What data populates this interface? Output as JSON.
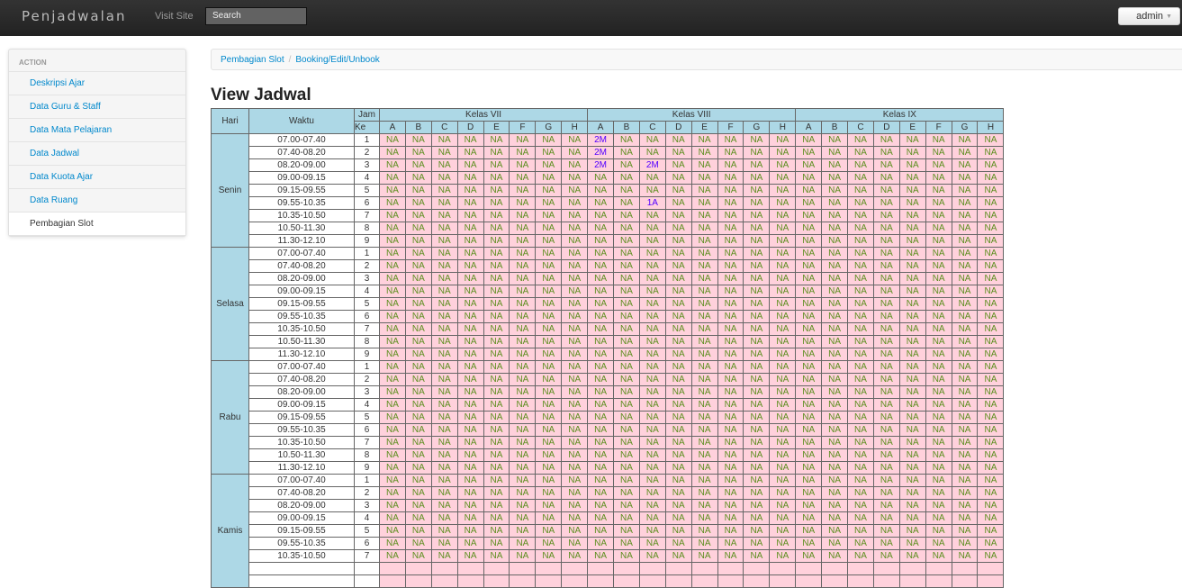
{
  "navbar": {
    "brand": "Penjadwalan",
    "visit_site": "Visit Site",
    "search_placeholder": "Search",
    "user": "admin"
  },
  "sidebar": {
    "header": "ACTION",
    "items": [
      {
        "label": "Deskripsi Ajar"
      },
      {
        "label": "Data Guru & Staff"
      },
      {
        "label": "Data Mata Pelajaran"
      },
      {
        "label": "Data Jadwal"
      },
      {
        "label": "Data Kuota Ajar"
      },
      {
        "label": "Data Ruang"
      },
      {
        "label": "Pembagian Slot",
        "active": true
      }
    ]
  },
  "breadcrumb": {
    "items": [
      "Pembagian Slot",
      "Booking/Edit/Unbook"
    ],
    "separator": "/"
  },
  "page_title": "View Jadwal",
  "table": {
    "headers": {
      "hari": "Hari",
      "waktu": "Waktu",
      "jam": "Jam",
      "ke": "Ke"
    },
    "kelas": [
      "Kelas VII",
      "Kelas VIII",
      "Kelas IX"
    ],
    "sections": [
      "A",
      "B",
      "C",
      "D",
      "E",
      "F",
      "G",
      "H"
    ],
    "default_cell": "NA",
    "days": [
      {
        "name": "Senin",
        "slots": [
          [
            "07.00-07.40",
            "1"
          ],
          [
            "07.40-08.20",
            "2"
          ],
          [
            "08.20-09.00",
            "3"
          ],
          [
            "09.00-09.15",
            "4"
          ],
          [
            "09.15-09.55",
            "5"
          ],
          [
            "09.55-10.35",
            "6"
          ],
          [
            "10.35-10.50",
            "7"
          ],
          [
            "10.50-11.30",
            "8"
          ],
          [
            "11.30-12.10",
            "9"
          ]
        ]
      },
      {
        "name": "Selasa",
        "slots": [
          [
            "07.00-07.40",
            "1"
          ],
          [
            "07.40-08.20",
            "2"
          ],
          [
            "08.20-09.00",
            "3"
          ],
          [
            "09.00-09.15",
            "4"
          ],
          [
            "09.15-09.55",
            "5"
          ],
          [
            "09.55-10.35",
            "6"
          ],
          [
            "10.35-10.50",
            "7"
          ],
          [
            "10.50-11.30",
            "8"
          ],
          [
            "11.30-12.10",
            "9"
          ]
        ]
      },
      {
        "name": "Rabu",
        "slots": [
          [
            "07.00-07.40",
            "1"
          ],
          [
            "07.40-08.20",
            "2"
          ],
          [
            "08.20-09.00",
            "3"
          ],
          [
            "09.00-09.15",
            "4"
          ],
          [
            "09.15-09.55",
            "5"
          ],
          [
            "09.55-10.35",
            "6"
          ],
          [
            "10.35-10.50",
            "7"
          ],
          [
            "10.50-11.30",
            "8"
          ],
          [
            "11.30-12.10",
            "9"
          ]
        ]
      },
      {
        "name": "Kamis",
        "slots": [
          [
            "07.00-07.40",
            "1"
          ],
          [
            "07.40-08.20",
            "2"
          ],
          [
            "08.20-09.00",
            "3"
          ],
          [
            "09.00-09.15",
            "4"
          ],
          [
            "09.15-09.55",
            "5"
          ],
          [
            "09.55-10.35",
            "6"
          ],
          [
            "10.35-10.50",
            "7"
          ]
        ]
      }
    ],
    "bookings": [
      {
        "day": "Senin",
        "jam": "1",
        "kelas": "Kelas VIII",
        "section": "A",
        "value": "2M"
      },
      {
        "day": "Senin",
        "jam": "2",
        "kelas": "Kelas VIII",
        "section": "A",
        "value": "2M"
      },
      {
        "day": "Senin",
        "jam": "3",
        "kelas": "Kelas VIII",
        "section": "A",
        "value": "2M"
      },
      {
        "day": "Senin",
        "jam": "3",
        "kelas": "Kelas VIII",
        "section": "C",
        "value": "2M"
      },
      {
        "day": "Senin",
        "jam": "6",
        "kelas": "Kelas VIII",
        "section": "C",
        "value": "1A"
      }
    ]
  },
  "colors": {
    "header_bg": "#add8e6",
    "cell_bg": "#ffd1dc",
    "na_text": "#5c8e1e",
    "booked_text": "#5500ff"
  }
}
